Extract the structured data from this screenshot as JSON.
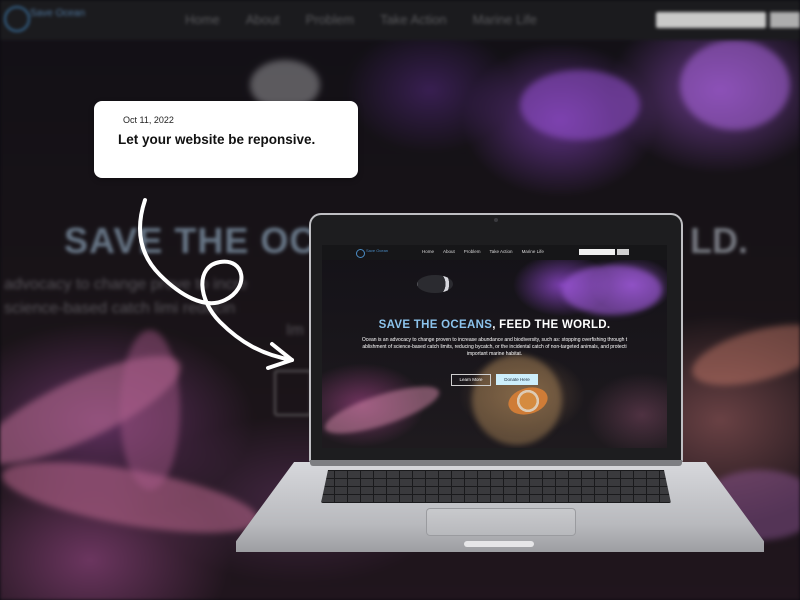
{
  "background_page": {
    "nav": {
      "logo_text": "Save Ocean",
      "links": [
        "Home",
        "About",
        "Problem",
        "Take Action",
        "Marine Life"
      ]
    },
    "hero_title_start": "SAVE THE OCE",
    "hero_title_end": "LD.",
    "blur_lines": [
      "advocacy to change prove to incre",
      "science-based catch limi  reducin",
      "Im"
    ]
  },
  "card": {
    "date": "Oct 11, 2022",
    "title": "Let your website be reponsive."
  },
  "laptop_site": {
    "nav": {
      "logo_text": "Save Ocean",
      "links": [
        "Home",
        "About",
        "Problem",
        "Take Action",
        "Marine Life"
      ]
    },
    "hero": {
      "title_accent": "SAVE THE OCEANS",
      "title_rest": ", FEED THE WORLD.",
      "paragraph_line1": "Ocean is an advocacy to change proven to increase abundance and biodiversity, such as: stopping overfishing through t",
      "paragraph_line2": "ablishment of science-based catch limits, reducing bycatch, or the incidental catch of non-targeted animals, and protecti",
      "paragraph_line3": "important marine habitat."
    },
    "buttons": {
      "learn_more": "Learn More",
      "donate": "Donate Here"
    }
  },
  "colors": {
    "accent": "#8cc3ec",
    "donate_button": "#cdeefb",
    "card_bg": "#ffffff"
  }
}
